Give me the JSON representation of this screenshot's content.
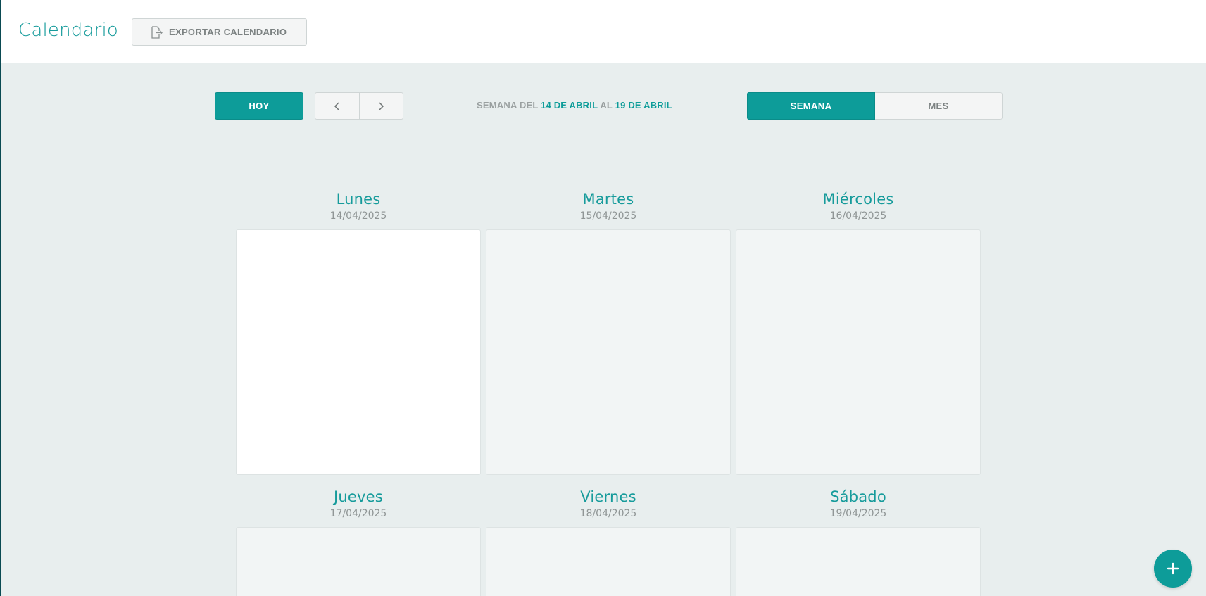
{
  "header": {
    "title": "Calendario",
    "export_label": "EXPORTAR CALENDARIO"
  },
  "toolbar": {
    "today_label": "HOY",
    "range_prefix": "SEMANA DEL",
    "range_start": "14 DE ABRIL",
    "range_mid": "AL",
    "range_end": "19 DE ABRIL",
    "view_week": "SEMANA",
    "view_month": "MES",
    "active_view": "SEMANA"
  },
  "days": [
    {
      "name": "Lunes",
      "date": "14/04/2025",
      "today": true
    },
    {
      "name": "Martes",
      "date": "15/04/2025",
      "today": false
    },
    {
      "name": "Miércoles",
      "date": "16/04/2025",
      "today": false
    },
    {
      "name": "Jueves",
      "date": "17/04/2025",
      "today": false
    },
    {
      "name": "Viernes",
      "date": "18/04/2025",
      "today": false
    },
    {
      "name": "Sábado",
      "date": "19/04/2025",
      "today": false
    }
  ],
  "colors": {
    "accent": "#0d9c99",
    "title": "#169b9b",
    "background": "#e8eeee"
  },
  "icons": {
    "export": "file-export-icon",
    "prev": "chevron-left-icon",
    "next": "chevron-right-icon",
    "add": "plus-icon"
  }
}
